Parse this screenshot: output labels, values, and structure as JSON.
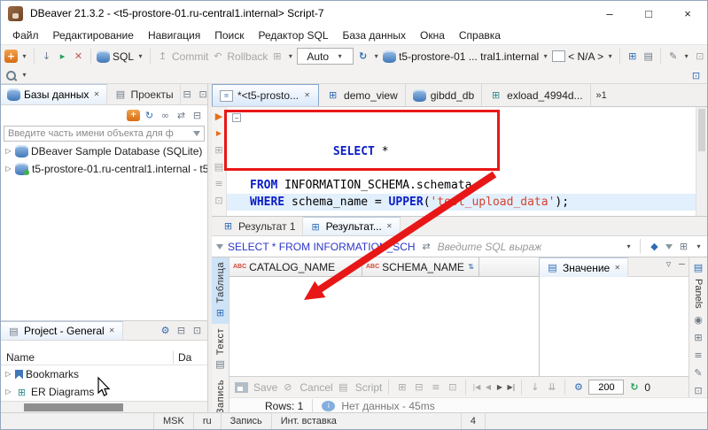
{
  "window": {
    "title": "DBeaver 21.3.2 - <t5-prostore-01.ru-central1.internal> Script-7",
    "minimize": "–",
    "maximize": "□",
    "close": "×"
  },
  "menubar": {
    "items": [
      "Файл",
      "Редактирование",
      "Навигация",
      "Поиск",
      "Редактор SQL",
      "База данных",
      "Окна",
      "Справка"
    ]
  },
  "toolbar": {
    "sql": "SQL",
    "commit": "Commit",
    "rollback": "Rollback",
    "auto": "Auto",
    "connection": "t5-prostore-01 ... tral1.internal",
    "na": "< N/A >"
  },
  "dbnav": {
    "tab_databases": "Базы данных",
    "tab_projects": "Проекты",
    "filter_placeholder": "Введите часть имени объекта для ф",
    "tree": [
      {
        "label": "DBeaver Sample Database (SQLite)"
      },
      {
        "label": "t5-prostore-01.ru-central1.internal - t5"
      }
    ]
  },
  "project": {
    "tab": "Project - General",
    "col_name": "Name",
    "col_date": "Da",
    "items": [
      {
        "label": "Bookmarks"
      },
      {
        "label": "ER Diagrams"
      }
    ]
  },
  "editor": {
    "tabs": [
      {
        "label": "*<t5-prosto..."
      },
      {
        "label": "demo_view"
      },
      {
        "label": "gibdd_db"
      },
      {
        "label": "exload_4994d..."
      }
    ],
    "overflow": "»1",
    "code": [
      [
        {
          "t": "SELECT",
          "c": "kw"
        },
        {
          "t": " *",
          "c": "p"
        }
      ],
      [
        {
          "t": "FROM",
          "c": "kw"
        },
        {
          "t": " INFORMATION_SCHEMA.schemata",
          "c": "p"
        }
      ],
      [
        {
          "t": "WHERE",
          "c": "kw"
        },
        {
          "t": " schema_name = ",
          "c": "p"
        },
        {
          "t": "UPPER",
          "c": "kw"
        },
        {
          "t": "(",
          "c": "p"
        },
        {
          "t": "'test_upload_data'",
          "c": "str"
        },
        {
          "t": ");",
          "c": "p"
        }
      ]
    ]
  },
  "results": {
    "tab1": "Результат 1",
    "tab2": "Результат...",
    "filter_query": "SELECT * FROM INFORMATION_SCH",
    "filter_placeholder": "Введите SQL выраж",
    "side_tabs": [
      "Таблица",
      "Текст",
      "Запись"
    ],
    "type_icon": "ABC",
    "columns": [
      "CATALOG_NAME",
      "SCHEMA_NAME"
    ],
    "value_tab": "Значение",
    "panels_tab": "Panels",
    "save": "Save",
    "cancel": "Cancel",
    "script": "Script",
    "fetch_size": "200",
    "refresh_count": "0",
    "rows": "Rows: 1",
    "message": "Нет данных - 45ms"
  },
  "statusbar": {
    "tz": "MSK",
    "lang": "ru",
    "mode": "Запись",
    "insert": "Инт. вставка",
    "pos": "4"
  }
}
